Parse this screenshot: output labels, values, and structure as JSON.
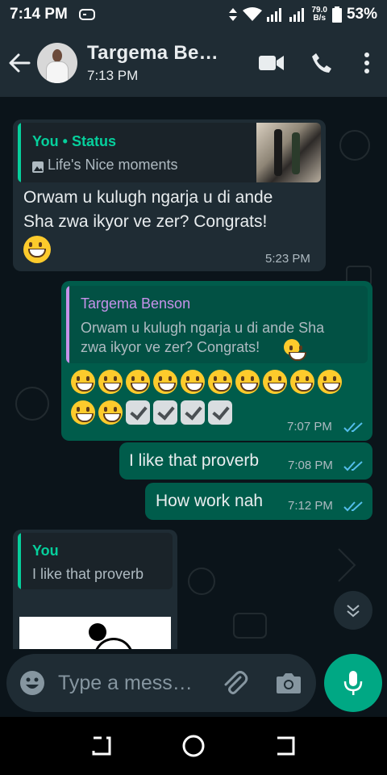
{
  "status_bar": {
    "time": "7:14 PM",
    "speed_top": "79.0",
    "speed_unit": "B/s",
    "battery": "53%"
  },
  "header": {
    "contact_name": "Targema Be…",
    "last_seen": "7:13 PM"
  },
  "messages": [
    {
      "direction": "incoming",
      "quote_title": "You • Status",
      "quote_text": "Life's Nice moments",
      "text_line1": "Orwam u kulugh ngarja u di ande",
      "text_line2": "Sha zwa ikyor ve zer? Congrats!",
      "time": "5:23 PM"
    },
    {
      "direction": "outgoing",
      "quote_title": "Targema Benson",
      "quote_line1": "Orwam u kulugh ngarja u di ande Sha",
      "quote_line2": "zwa ikyor ve zer? Congrats!",
      "time": "7:07 PM"
    },
    {
      "direction": "outgoing",
      "text": "I like that proverb",
      "time": "7:08 PM"
    },
    {
      "direction": "outgoing",
      "text": "How work nah",
      "time": "7:12 PM"
    },
    {
      "direction": "incoming",
      "quote_title": "You",
      "quote_text": "I like that proverb"
    }
  ],
  "input": {
    "placeholder": "Type a mess…"
  },
  "colors": {
    "accent": "#00a884",
    "outgoing_bubble": "#005c4b",
    "incoming_bubble": "#1f2c34",
    "read_ticks": "#53bdeb",
    "quote_you": "#06cf9c",
    "quote_other": "#c792ea"
  },
  "icons": {
    "back": "arrow-left-icon",
    "video": "video-call-icon",
    "call": "phone-icon",
    "menu": "more-vert-icon",
    "emoji": "emoji-icon",
    "attach": "paperclip-icon",
    "camera": "camera-icon",
    "mic": "mic-icon"
  }
}
